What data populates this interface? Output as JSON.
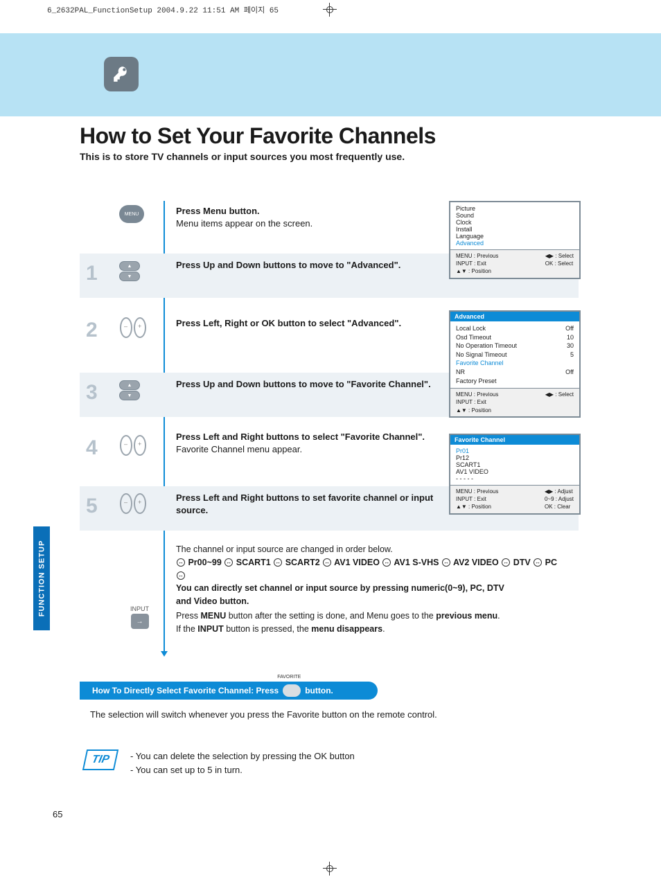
{
  "print_header": "6_2632PAL_FunctionSetup  2004.9.22 11:51 AM  페이지 65",
  "title": "How to Set Your Favorite Channels",
  "subtitle": "This is to store TV channels or input sources you most frequently use.",
  "side_tab": "FUNCTION SETUP",
  "menu_btn_label": "MENU",
  "input_btn_label": "INPUT",
  "step0": {
    "text1": "Press Menu button.",
    "text2": "Menu items appear on the screen."
  },
  "steps": [
    {
      "num": "1",
      "text": "Press Up and Down buttons to move to \"Advanced\"."
    },
    {
      "num": "2",
      "text": "Press Left, Right or OK button to select \"Advanced\"."
    },
    {
      "num": "3",
      "text": "Press Up and Down buttons to move to \"Favorite Channel\"."
    },
    {
      "num": "4",
      "text1": "Press Left and Right buttons to select \"Favorite Channel\".",
      "text2": "Favorite Channel menu appear."
    },
    {
      "num": "5",
      "text": "Press Left and Right buttons to set favorite channel or input source."
    }
  ],
  "explain": {
    "line1": "The channel or input source are changed in order below.",
    "cycle": [
      "Pr00~99",
      "SCART1",
      "SCART2",
      "AV1 VIDEO",
      "AV1 S-VHS",
      "AV2 VIDEO",
      "DTV",
      "PC"
    ],
    "line3a": "You can directly set channel or input source by pressing numeric(0~9), PC, DTV",
    "line3b": "and Video button."
  },
  "final": {
    "line1a": "Press ",
    "line1b": "MENU",
    "line1c": " button after the setting is done, and Menu goes to the ",
    "line1d": "previous menu",
    "line1e": ".",
    "line2a": "If the ",
    "line2b": "INPUT",
    "line2c": " button is pressed, the ",
    "line2d": "menu disappears",
    "line2e": "."
  },
  "osd1": {
    "items": [
      "Picture",
      "Sound",
      "Clock",
      "Install",
      "Language",
      "Advanced"
    ],
    "highlight_index": 5,
    "foot_l": [
      "MENU : Previous",
      "INPUT : Exit",
      "▲▼ : Position"
    ],
    "foot_r": [
      "◀▶ : Select",
      "OK : Select"
    ]
  },
  "osd2": {
    "header": "Advanced",
    "rows": [
      {
        "k": "Local Lock",
        "v": "Off"
      },
      {
        "k": "Osd Timeout",
        "v": "10"
      },
      {
        "k": "No Operation Timeout",
        "v": "30"
      },
      {
        "k": "No Signal Timeout",
        "v": "5"
      },
      {
        "k": "Favorite Channel",
        "v": "",
        "hl": true
      },
      {
        "k": "NR",
        "v": "Off"
      },
      {
        "k": "Factory Preset",
        "v": ""
      }
    ],
    "foot_l": [
      "MENU : Previous",
      "INPUT : Exit",
      "▲▼ : Position"
    ],
    "foot_r": [
      "◀▶ : Select"
    ]
  },
  "osd3": {
    "header": "Favorite Channel",
    "items": [
      "Pr01",
      "Pr12",
      "SCART1",
      "AV1 VIDEO",
      "- - - - -"
    ],
    "highlight_index": 0,
    "foot_l": [
      "MENU : Previous",
      "INPUT : Exit",
      "▲▼ : Position"
    ],
    "foot_r": [
      "◀▶ : Adjust",
      "0~9 : Adjust",
      "OK : Clear"
    ]
  },
  "blue_bar": {
    "prefix": "How To Directly Select ",
    "bold": "Favorite Channel",
    "mid": " : Press",
    "fav_label": "FAVORITE",
    "suffix": "button."
  },
  "after_blue": "The selection will switch whenever you press the Favorite button on the remote control.",
  "tip_label": "TIP",
  "tip_lines": [
    "- You can delete the selection by pressing the OK button",
    "- You can set up to 5 in turn."
  ],
  "page_number": "65"
}
